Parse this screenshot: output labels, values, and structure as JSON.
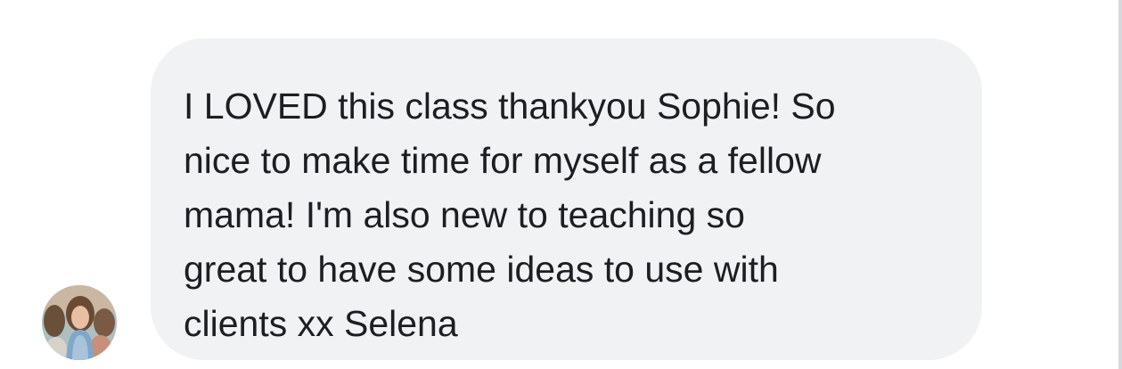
{
  "message": {
    "lines": [
      "I LOVED this class thankyou Sophie! So",
      "nice to make time for myself as a fellow",
      "mama! I'm also new to teaching so",
      "great to have some ideas to use with",
      "clients xx Selena"
    ]
  },
  "colors": {
    "bubble_background": "#f1f2f4",
    "text": "#1c1e21",
    "page_background": "#ffffff"
  },
  "icons": {
    "avatar": "profile-photo"
  }
}
